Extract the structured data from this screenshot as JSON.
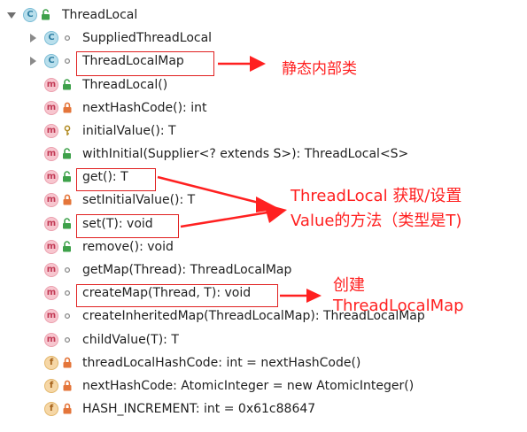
{
  "tree": [
    {
      "kind": "c",
      "mod": "public",
      "expand": "open",
      "label": "ThreadLocal"
    },
    {
      "kind": "c",
      "mod": "package",
      "expand": "closed",
      "label": "SuppliedThreadLocal"
    },
    {
      "kind": "c",
      "mod": "package",
      "expand": "closed",
      "label": "ThreadLocalMap"
    },
    {
      "kind": "m",
      "mod": "public",
      "label": "ThreadLocal()"
    },
    {
      "kind": "m",
      "mod": "private",
      "label": "nextHashCode(): int"
    },
    {
      "kind": "m",
      "mod": "protected",
      "label": "initialValue(): T"
    },
    {
      "kind": "m",
      "mod": "public",
      "label": "withInitial(Supplier<? extends S>): ThreadLocal<S>"
    },
    {
      "kind": "m",
      "mod": "public",
      "label": "get(): T"
    },
    {
      "kind": "m",
      "mod": "private",
      "label": "setInitialValue(): T"
    },
    {
      "kind": "m",
      "mod": "public",
      "label": "set(T): void"
    },
    {
      "kind": "m",
      "mod": "public",
      "label": "remove(): void"
    },
    {
      "kind": "m",
      "mod": "package",
      "label": "getMap(Thread): ThreadLocalMap"
    },
    {
      "kind": "m",
      "mod": "package",
      "label": "createMap(Thread, T): void"
    },
    {
      "kind": "m",
      "mod": "package",
      "label": "createInheritedMap(ThreadLocalMap): ThreadLocalMap"
    },
    {
      "kind": "m",
      "mod": "package",
      "label": "childValue(T): T"
    },
    {
      "kind": "f",
      "mod": "private",
      "label": "threadLocalHashCode: int = nextHashCode()"
    },
    {
      "kind": "f",
      "mod": "private",
      "label": "nextHashCode: AtomicInteger = new AtomicInteger()"
    },
    {
      "kind": "f",
      "mod": "private",
      "label": "HASH_INCREMENT: int = 0x61c88647"
    }
  ],
  "annotations": {
    "static_inner": "静态内部类",
    "get_set_line1": "ThreadLocal 获取/设置",
    "get_set_line2": "Value的方法（类型是T)",
    "create_line1": "创建",
    "create_line2": "ThreadLocalMap"
  },
  "colors": {
    "annotation": "#ff2020",
    "highlight_box": "#e02020",
    "class_icon": "#b9dfec",
    "method_icon": "#f7c6cf",
    "field_icon": "#f6d7a6",
    "public_mod": "#3ea14a",
    "private_mod": "#e4753a",
    "protected_mod": "#c9a227"
  }
}
